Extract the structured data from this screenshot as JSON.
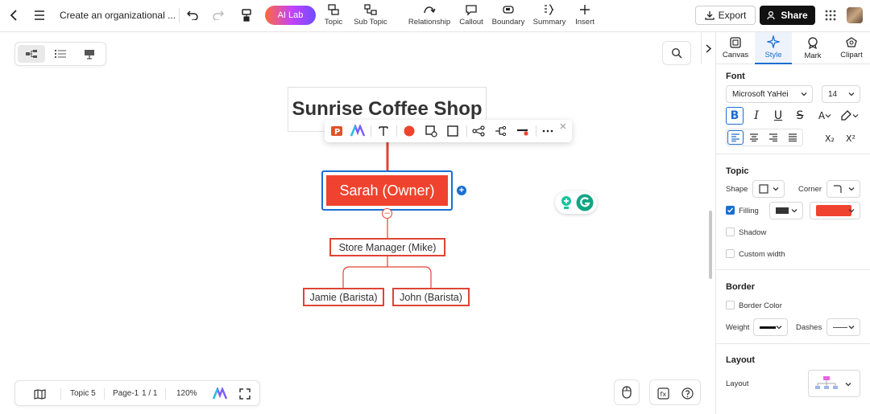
{
  "header": {
    "doc_title": "Create an organizational ...",
    "ai_lab": "AI Lab",
    "tools": [
      {
        "label": "Topic",
        "icon": "topic-icon"
      },
      {
        "label": "Sub Topic",
        "icon": "subtopic-icon"
      },
      {
        "label": "Relationship",
        "icon": "relationship-icon"
      },
      {
        "label": "Callout",
        "icon": "callout-icon"
      },
      {
        "label": "Boundary",
        "icon": "boundary-icon"
      },
      {
        "label": "Summary",
        "icon": "summary-icon"
      },
      {
        "label": "Insert",
        "icon": "plus-icon"
      }
    ],
    "export_label": "Export",
    "share_label": "Share"
  },
  "canvas": {
    "main_topic": "Sunrise Coffee Shop",
    "owner_topic": "Sarah (Owner)",
    "manager_topic": "Store Manager (Mike)",
    "barista_1": "Jamie (Barista)",
    "barista_2": "John (Barista)",
    "accent_color": "#f0432f",
    "selection_color": "#1a6fd1"
  },
  "statusbar": {
    "topic_count": "Topic 5",
    "page": "Page-1",
    "page_of": "1 / 1",
    "zoom": "120%"
  },
  "panel": {
    "tabs": [
      {
        "label": "Canvas",
        "icon": "canvas-icon"
      },
      {
        "label": "Style",
        "icon": "sparkle-icon"
      },
      {
        "label": "Mark",
        "icon": "mark-icon"
      },
      {
        "label": "Clipart",
        "icon": "clipart-icon"
      }
    ],
    "active_tab": "Style",
    "font": {
      "title": "Font",
      "family": "Microsoft YaHei",
      "size": "14",
      "format_buttons": [
        "B",
        "I",
        "U",
        "S",
        "A"
      ],
      "subscript": "X₂",
      "superscript": "X²"
    },
    "topic": {
      "title": "Topic",
      "shape_label": "Shape",
      "corner_label": "Corner",
      "filling_label": "Filling",
      "filling_checked": true,
      "fill_color": "#f0432f",
      "shadow_label": "Shadow",
      "custom_width_label": "Custom width"
    },
    "border": {
      "title": "Border",
      "border_color_label": "Border Color",
      "weight_label": "Weight",
      "dashes_label": "Dashes"
    },
    "layout": {
      "title": "Layout",
      "layout_label": "Layout"
    }
  }
}
